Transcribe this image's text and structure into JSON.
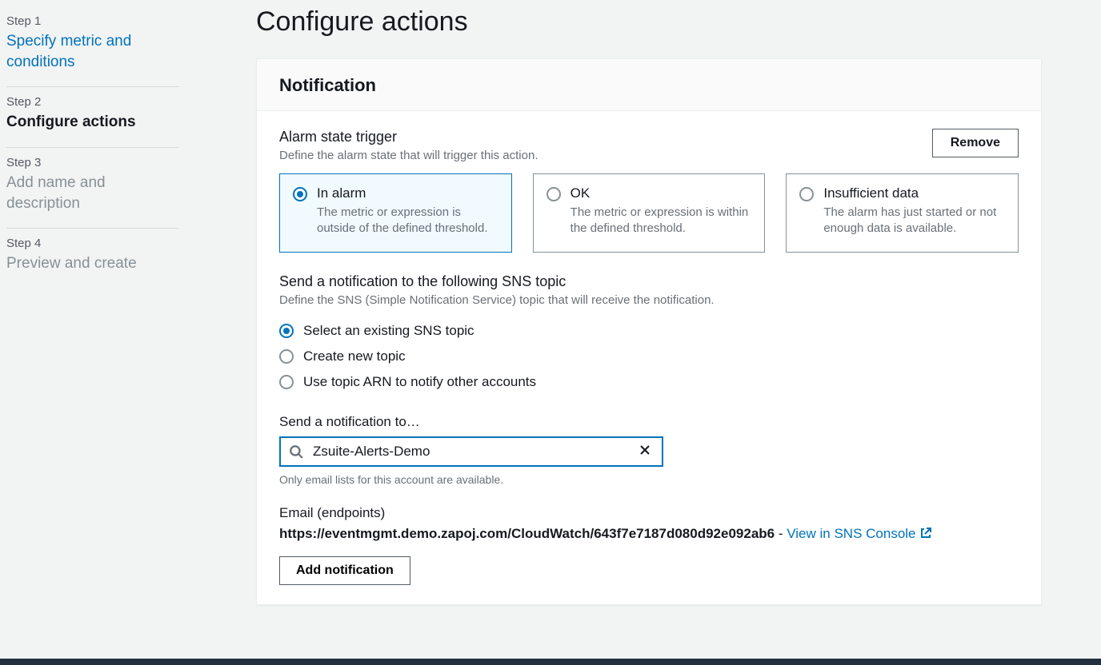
{
  "page": {
    "title": "Configure actions"
  },
  "steps": [
    {
      "num": "Step 1",
      "title": "Specify metric and conditions",
      "state": "link"
    },
    {
      "num": "Step 2",
      "title": "Configure actions",
      "state": "current"
    },
    {
      "num": "Step 3",
      "title": "Add name and description",
      "state": "future"
    },
    {
      "num": "Step 4",
      "title": "Preview and create",
      "state": "future"
    }
  ],
  "panel": {
    "heading": "Notification",
    "remove_label": "Remove",
    "trigger": {
      "title": "Alarm state trigger",
      "desc": "Define the alarm state that will trigger this action.",
      "options": [
        {
          "title": "In alarm",
          "desc": "The metric or expression is outside of the defined threshold.",
          "selected": true
        },
        {
          "title": "OK",
          "desc": "The metric or expression is within the defined threshold.",
          "selected": false
        },
        {
          "title": "Insufficient data",
          "desc": "The alarm has just started or not enough data is available.",
          "selected": false
        }
      ]
    },
    "sns": {
      "title": "Send a notification to the following SNS topic",
      "desc": "Define the SNS (Simple Notification Service) topic that will receive the notification.",
      "options": [
        {
          "label": "Select an existing SNS topic",
          "selected": true
        },
        {
          "label": "Create new topic",
          "selected": false
        },
        {
          "label": "Use topic ARN to notify other accounts",
          "selected": false
        }
      ]
    },
    "notify_to": {
      "label": "Send a notification to…",
      "value": "Zsuite-Alerts-Demo",
      "help": "Only email lists for this account are available."
    },
    "endpoints": {
      "label": "Email (endpoints)",
      "url": "https://eventmgmt.demo.zapoj.com/CloudWatch/643f7e7187d080d92e092ab6",
      "dash": " - ",
      "view": "View in SNS Console"
    },
    "add_notification_label": "Add notification"
  }
}
